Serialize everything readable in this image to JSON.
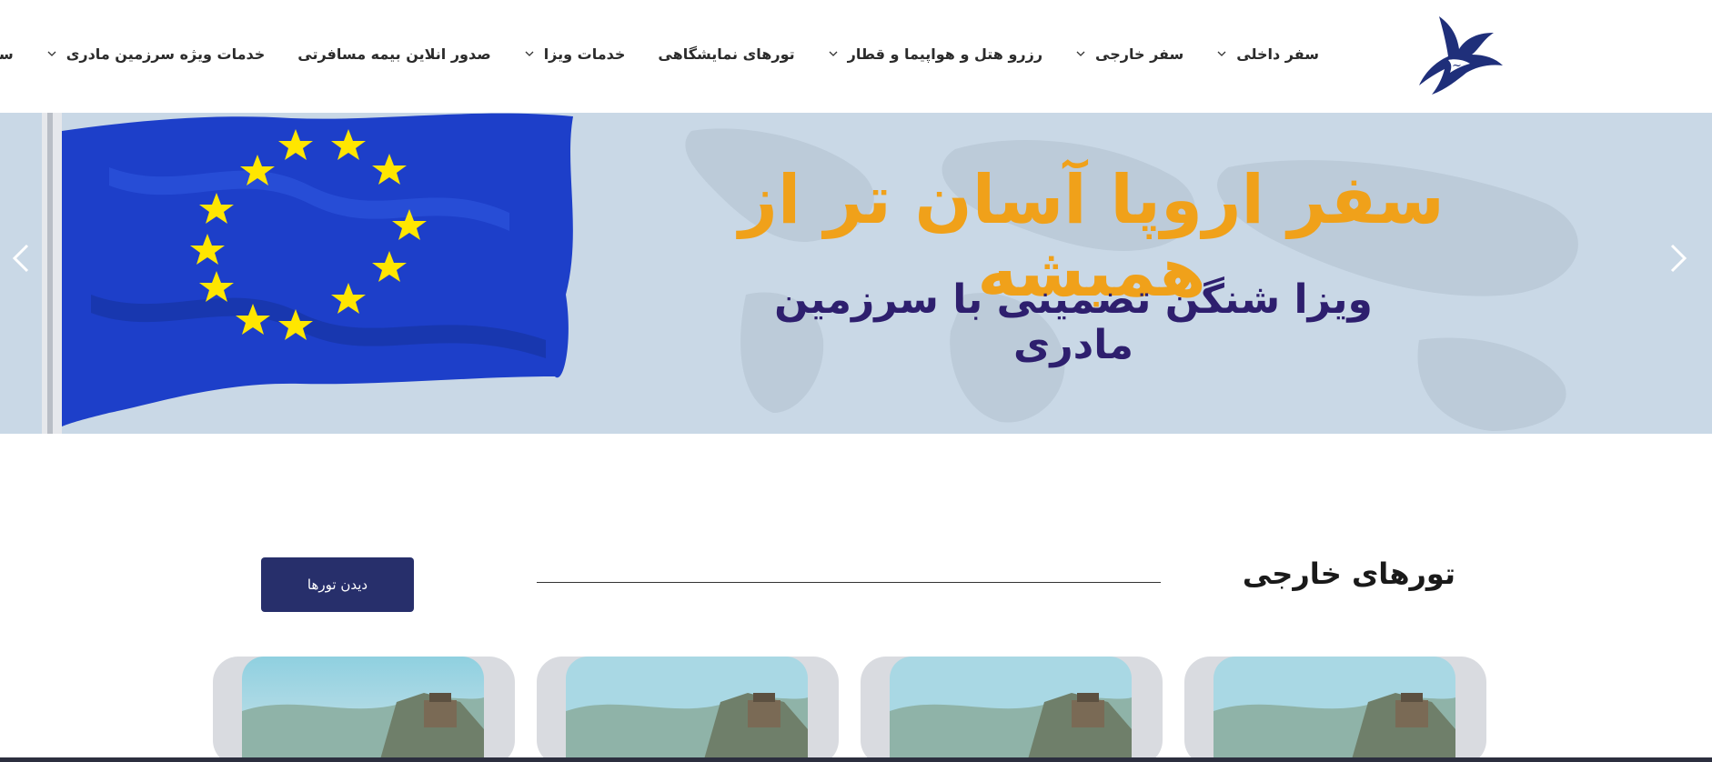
{
  "header": {
    "nav": [
      {
        "label": "سفر داخلی",
        "has_dropdown": true
      },
      {
        "label": "سفر خارجی",
        "has_dropdown": true
      },
      {
        "label": "رزرو هتل و هواپیما و قطار",
        "has_dropdown": true
      },
      {
        "label": "تورهای نمایشگاهی",
        "has_dropdown": false
      },
      {
        "label": "خدمات ویزا",
        "has_dropdown": true
      },
      {
        "label": "صدور انلاین بیمه مسافرتی",
        "has_dropdown": false
      },
      {
        "label": "خدمات ویژه سرزمین مادری",
        "has_dropdown": true
      },
      {
        "label": "سرزمین ما",
        "has_dropdown": true
      }
    ],
    "logo_icon": "bird-logo-icon"
  },
  "hero": {
    "title": "سفر اروپا آسان تر از همیشه",
    "subtitle": "ویزا شنگن تضمینی با سرزمین مادری",
    "title_color": "#f0a11a",
    "subtitle_color": "#2e1f6e",
    "prev_icon": "chevron-left-icon",
    "next_icon": "chevron-right-icon"
  },
  "section": {
    "title": "تورهای خارجی",
    "button_label": "دیدن تورها",
    "button_color": "#272f6b"
  },
  "cards": [
    {
      "image": "great-wall-photo"
    },
    {
      "image": "great-wall-photo"
    },
    {
      "image": "great-wall-photo"
    },
    {
      "image": "great-wall-photo"
    }
  ],
  "colors": {
    "brand_navy": "#272f6b",
    "hero_bg": "#c9d8e6",
    "card_bg": "#d9dbe0"
  }
}
